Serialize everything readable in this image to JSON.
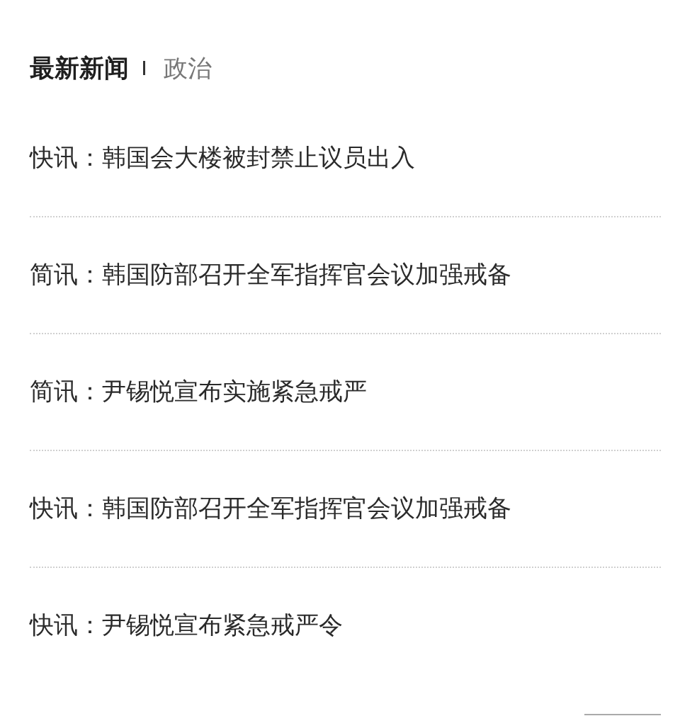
{
  "header": {
    "title": "最新新闻",
    "category": "政治"
  },
  "news_items": [
    {
      "headline": "快讯：韩国会大楼被封禁止议员出入"
    },
    {
      "headline": "简讯：韩国防部召开全军指挥官会议加强戒备"
    },
    {
      "headline": "简讯：尹锡悦宣布实施紧急戒严"
    },
    {
      "headline": "快讯：韩国防部召开全军指挥官会议加强戒备"
    },
    {
      "headline": "快讯：尹锡悦宣布紧急戒严令"
    }
  ]
}
